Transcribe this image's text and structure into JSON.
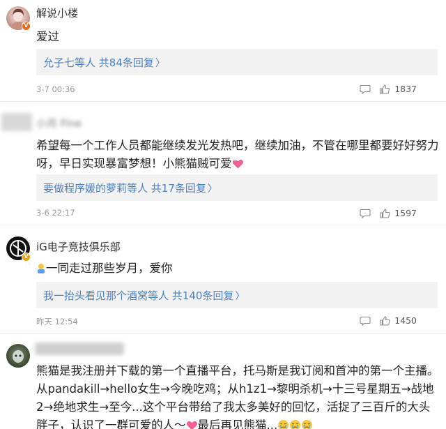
{
  "comments": [
    {
      "username": "解说小楼",
      "text": "爱过",
      "reply_summary": {
        "names": "允子七等人",
        "count_text": " 共84条回复"
      },
      "time": "3-7 00:36",
      "likes": "1837"
    },
    {
      "username": "小月 Fine",
      "text": "希望每一个工作人员都能继续发光发热吧，继续加油，不管在哪里都要好好努力呀，早日实现暴富梦想！小熊猫贼可爱",
      "reply_summary": {
        "names": "要做程序媛的萝莉等人",
        "count_text": " 共17条回复"
      },
      "time": "3-6 22:17",
      "likes": "1597"
    },
    {
      "username": "iG电子竞技俱乐部",
      "text": "一同走过那些岁月，爱你",
      "reply_summary": {
        "names": "我一抬头看见那个酒窝等人",
        "count_text": " 共140条回复"
      },
      "time": "昨天 12:54",
      "likes": "1450"
    },
    {
      "username": "",
      "text": "熊猫是我注册并下载的第一个直播平台，托马斯是我订阅和首冲的第一个主播。从pandakill→hello女生→今晚吃鸡；从h1z1→黎明杀机→十三号星期五→战地2→绝地求生→至今...这个平台带给了我太多美好的回忆，活捉了三百斤的大头胖子，认识了一群可爱的人～",
      "text_tail": "最后再见熊猫..."
    }
  ],
  "colors": {
    "link": "#4a7fc1",
    "reply_bg": "#f2f2f2",
    "verified_badge": "#e86a14",
    "timestamp": "#999999"
  },
  "icons": [
    "verified-badge-icon",
    "reply-icon",
    "like-icon",
    "heart-emoji",
    "person-emoji",
    "cry-emoji"
  ]
}
